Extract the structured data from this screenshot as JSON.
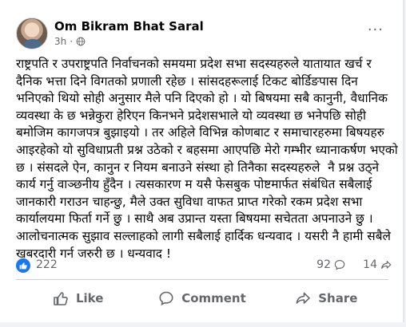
{
  "post": {
    "author": "Om Bikram Bhat Saral",
    "time": "3h",
    "more_label": "···",
    "text": "राष्ट्रपति र उपराष्ट्रपति निर्वाचनको समयमा प्रदेश सभा सदस्यहरुले यातायात खर्च र दैनिक भत्ता दिने विगतको प्रणाली रहेछ । सांसदहरूलाई टिकट बोर्डिङपास दिन भनिएको थियो सोही अनुसार मैले पनि दिएको हो । यो बिषयमा सबै कानुनी, वैधानिक व्यवस्था के छ भन्नेकुरा हेरिएन किनभने प्रदेशसभाले यो व्यवस्था छ भनेपछि सोही बमोजिम कागजपत्र बुझाइयो । तर अहिले विभिन्न कोणबाट र समाचारहरुमा बिषयहरु आइरहेको यो सुविधाप्रती प्रश्न उठेको र बहसमा आएपछि मेरो गम्भीर ध्यानाकर्षण भएको छ । संसदले ऐन, कानुन र नियम बनाउने संस्था हो तिनैका सदस्यहरुले  नै प्रश्न उठ्ने कार्य गर्नु वाञ्छनीय हुँदैन । त्यसकारण म यसै फेसबुक पोष्टमार्फत संबंधित सबैलाई जानकारी गराउन चाहन्छु, मैले उक्त सुविधा वाफत प्राप्त गरेको रकम प्रदेश सभा कार्यालयमा फिर्ता गर्ने छु । साथै अब उप्रान्त यस्ता बिषयमा सचेतता अपनाउने छु । आलोचनात्मक सुझाव सल्लाहको लागी सबैलाई हार्दिक धन्यवाद । यसरी नै हामी सबैले खबरदारी गर्न जरुरी छ । धन्यवाद !"
  },
  "stats": {
    "reactions": "222",
    "comments": "92",
    "shares": "14"
  },
  "actions": {
    "like": "Like",
    "comment": "Comment",
    "share": "Share"
  },
  "colors": {
    "accent": "#1877f2",
    "muted": "#65676b",
    "text": "#050505"
  },
  "icons": [
    "globe-icon",
    "more-options-icon",
    "like-reaction-icon",
    "comment-icon",
    "share-icon",
    "thumbs-up-icon"
  ]
}
